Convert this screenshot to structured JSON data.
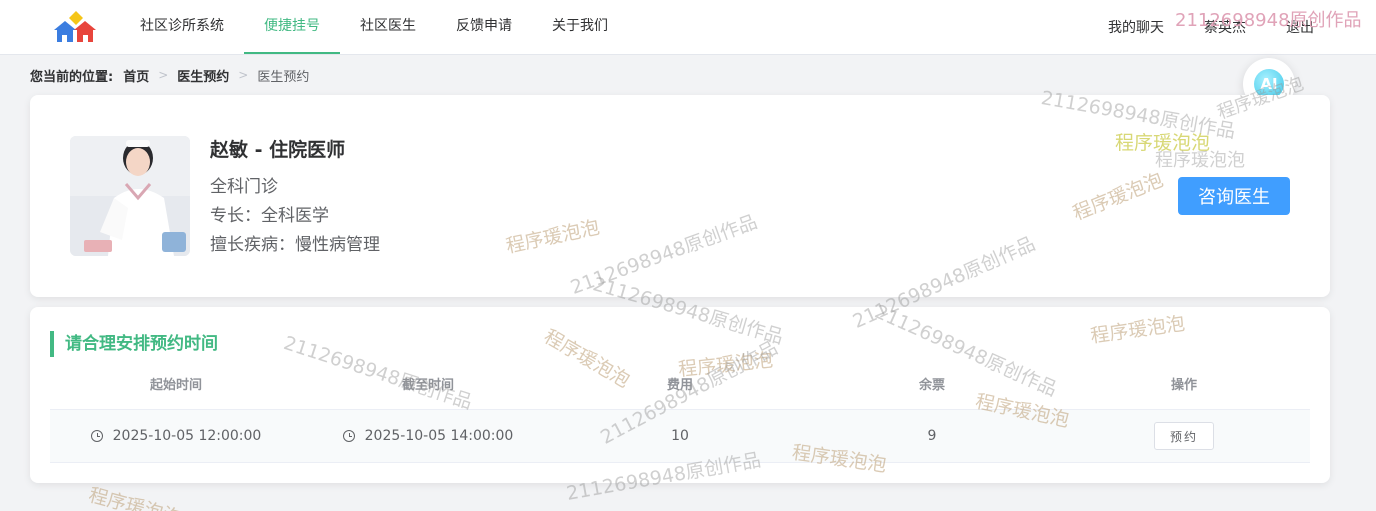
{
  "nav": {
    "items": [
      "社区诊所系统",
      "便捷挂号",
      "社区医生",
      "反馈申请",
      "关于我们"
    ],
    "active_index": 1,
    "right": {
      "chat": "我的聊天",
      "user": "蔡英杰",
      "logout": "退出"
    }
  },
  "breadcrumb": {
    "prefix": "您当前的位置:",
    "items": [
      "首页",
      "医生预约",
      "医生预约"
    ]
  },
  "ai_button": {
    "label": "AI"
  },
  "doctor": {
    "name_title": "赵敏 - 住院医师",
    "department": "全科门诊",
    "specialty": "专长：全科医学",
    "disease": "擅长疾病：慢性病管理",
    "consult_label": "咨询医生"
  },
  "schedule": {
    "title": "请合理安排预约时间",
    "columns": [
      "起始时间",
      "截至时间",
      "费用",
      "余票",
      "操作"
    ],
    "rows": [
      {
        "start": "2025-10-05 12:00:00",
        "end": "2025-10-05 14:00:00",
        "fee": "10",
        "remaining": "9",
        "action": "预约"
      }
    ]
  },
  "watermarks": [
    "2112698948原创作品",
    "程序瑗泡泡"
  ],
  "colors": {
    "primary_green": "#42b983",
    "primary_blue": "#409eff"
  }
}
